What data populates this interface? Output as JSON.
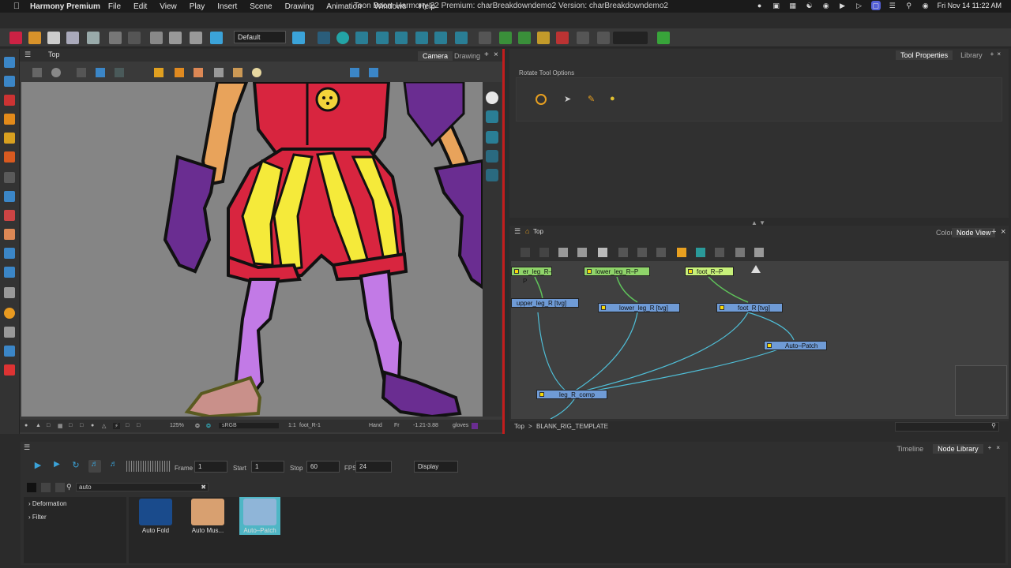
{
  "menubar": {
    "app_name": "Harmony Premium",
    "menus": [
      "File",
      "Edit",
      "View",
      "Play",
      "Insert",
      "Scene",
      "Drawing",
      "Animation",
      "Windows",
      "Help"
    ],
    "document_title": "Toon Boom Harmony 22 Premium: charBreakdowndemo2 Version: charBreakdowndemo2",
    "datetime": "Fri Nov 14  11:22 AM"
  },
  "toolbar": {
    "workspace_select": "Default"
  },
  "camera": {
    "title": "Top",
    "tabs": [
      "Camera",
      "Drawing"
    ],
    "footer": {
      "zoom": "125%",
      "color_space": "sRGB",
      "ratio": "1:1",
      "element": "foot_R-1",
      "tool": "Hand",
      "frame": "Fr",
      "coords": "-1.21-3.88",
      "layer": "gloves"
    }
  },
  "tool_properties": {
    "tabs": [
      "Tool Properties",
      "Library"
    ],
    "section_label": "Rotate Tool Options"
  },
  "node_view": {
    "title": "Top",
    "tabs": [
      "Colour",
      "Node View"
    ],
    "nodes": {
      "upper_leg_peg": "er_leg_R–P",
      "lower_leg_peg": "lower_leg_R–P",
      "foot_peg": "foot_R–P",
      "upper_leg": "upper_leg_R  [tvg]",
      "lower_leg": "lower_leg_R  [tvg]",
      "foot": "foot_R  [tvg]",
      "auto_patch": "Auto–Patch",
      "composite": "leg_R_comp"
    },
    "breadcrumb": [
      "Top",
      ">",
      "BLANK_RIG_TEMPLATE"
    ]
  },
  "timeline": {
    "tabs": [
      "Timeline",
      "Node Library"
    ],
    "frame_label": "Frame",
    "frame_value": "1",
    "start_label": "Start",
    "start_value": "1",
    "stop_label": "Stop",
    "stop_value": "60",
    "fps_label": "FPS",
    "fps_value": "24",
    "display_select": "Display"
  },
  "node_library": {
    "search_value": "auto",
    "categories": [
      "Deformation",
      "Filter"
    ],
    "items": [
      {
        "label": "Auto Fold"
      },
      {
        "label": "Auto Mus..."
      },
      {
        "label": "Auto–Patch"
      }
    ]
  },
  "colors": {
    "accent_blue": "#1fa0d6",
    "camera_border": "#c21d1d",
    "node_peg": "#8fd46a",
    "node_read": "#6f9bd6",
    "selected_item": "#4fb6c5"
  }
}
